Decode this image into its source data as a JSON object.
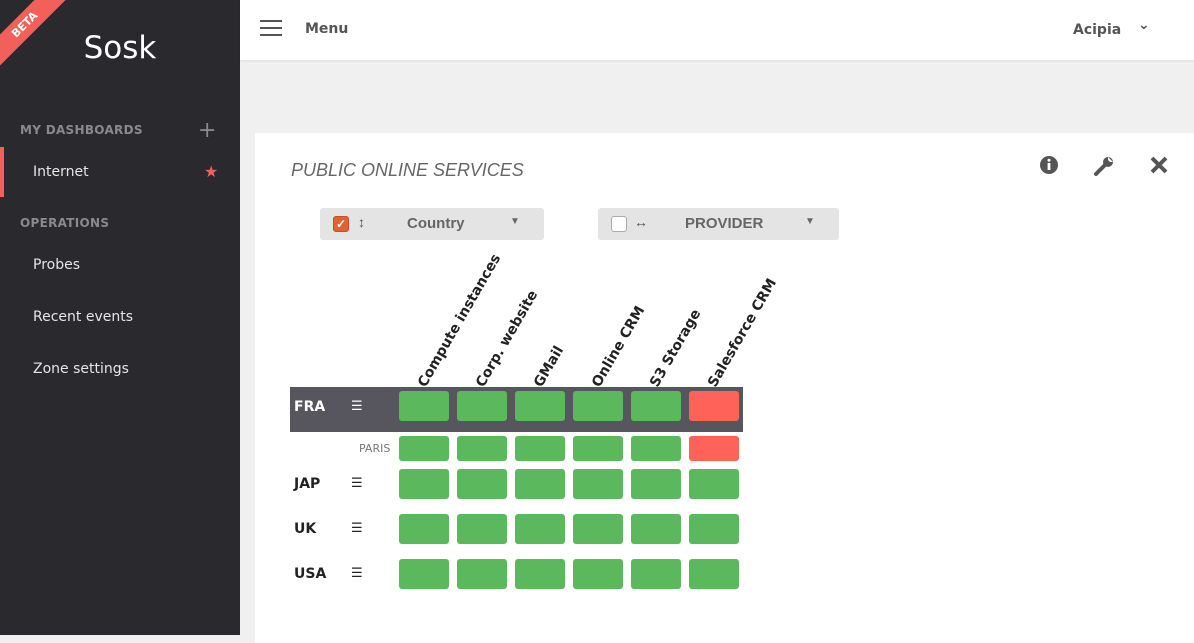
{
  "sidebar": {
    "badge": "BETA",
    "logo": "Sosk",
    "my_dashboards": "MY DASHBOARDS",
    "dashboards": [
      {
        "label": "Internet",
        "favorite": true
      }
    ],
    "operations": "OPERATIONS",
    "ops": [
      {
        "label": "Probes"
      },
      {
        "label": "Recent events"
      },
      {
        "label": "Zone settings"
      }
    ]
  },
  "header": {
    "menu": "Menu",
    "user": "Acipia"
  },
  "panel": {
    "title": "PUBLIC ONLINE SERVICES",
    "row_selector": {
      "label": "Country",
      "checked": true
    },
    "col_selector": {
      "label": "PROVIDER",
      "checked": false
    },
    "columns": [
      "Compute instances",
      "Corp. website",
      "GMail",
      "Online CRM",
      "S3 Storage",
      "Salesforce CRM"
    ],
    "rows": [
      {
        "label": "FRA",
        "status": [
          "ok",
          "ok",
          "ok",
          "ok",
          "ok",
          "error"
        ],
        "children": [
          {
            "label": "PARIS",
            "status": [
              "ok",
              "ok",
              "ok",
              "ok",
              "ok",
              "error"
            ]
          }
        ]
      },
      {
        "label": "JAP",
        "status": [
          "ok",
          "ok",
          "ok",
          "ok",
          "ok",
          "ok"
        ]
      },
      {
        "label": "UK",
        "status": [
          "ok",
          "ok",
          "ok",
          "ok",
          "ok",
          "ok"
        ]
      },
      {
        "label": "USA",
        "status": [
          "ok",
          "ok",
          "ok",
          "ok",
          "ok",
          "ok"
        ]
      }
    ]
  },
  "colors": {
    "ok": "#5cb85c",
    "error": "#ff6259",
    "accent": "#f2605a"
  }
}
